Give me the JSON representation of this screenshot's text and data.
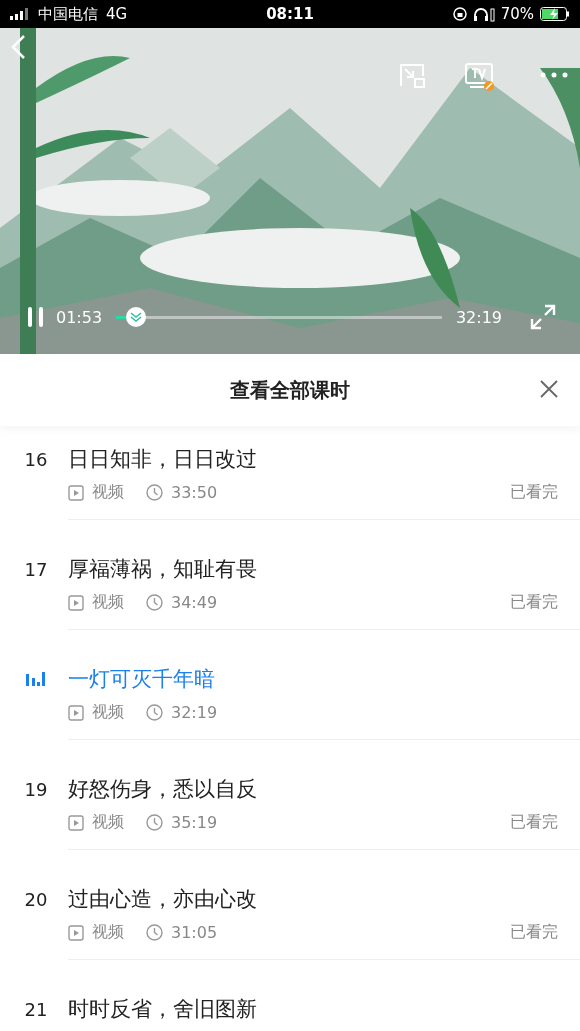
{
  "status_bar": {
    "carrier": "中国电信",
    "network": "4G",
    "time": "08:11",
    "battery": "70%"
  },
  "player": {
    "current_time": "01:53",
    "total_time": "32:19",
    "progress": {
      "level": 0.06
    },
    "playing": true
  },
  "panel": {
    "title": "查看全部课时"
  },
  "lessons": [
    {
      "number": "16",
      "title": "日日知非，日日改过",
      "type": "视频",
      "duration": "33:50",
      "status": "已看完",
      "selected": false
    },
    {
      "number": "17",
      "title": "厚福薄祸，知耻有畏",
      "type": "视频",
      "duration": "34:49",
      "status": "已看完",
      "selected": false
    },
    {
      "title": "一灯可灭千年暗",
      "type": "视频",
      "duration": "32:19",
      "selected": true
    },
    {
      "number": "19",
      "title": "好怒伤身，悉以自反",
      "type": "视频",
      "duration": "35:19",
      "status": "已看完",
      "selected": false
    },
    {
      "number": "20",
      "title": "过由心造，亦由心改",
      "type": "视频",
      "duration": "31:05",
      "status": "已看完",
      "selected": false
    },
    {
      "number": "21",
      "title": "时时反省，舍旧图新",
      "selected": false
    }
  ]
}
